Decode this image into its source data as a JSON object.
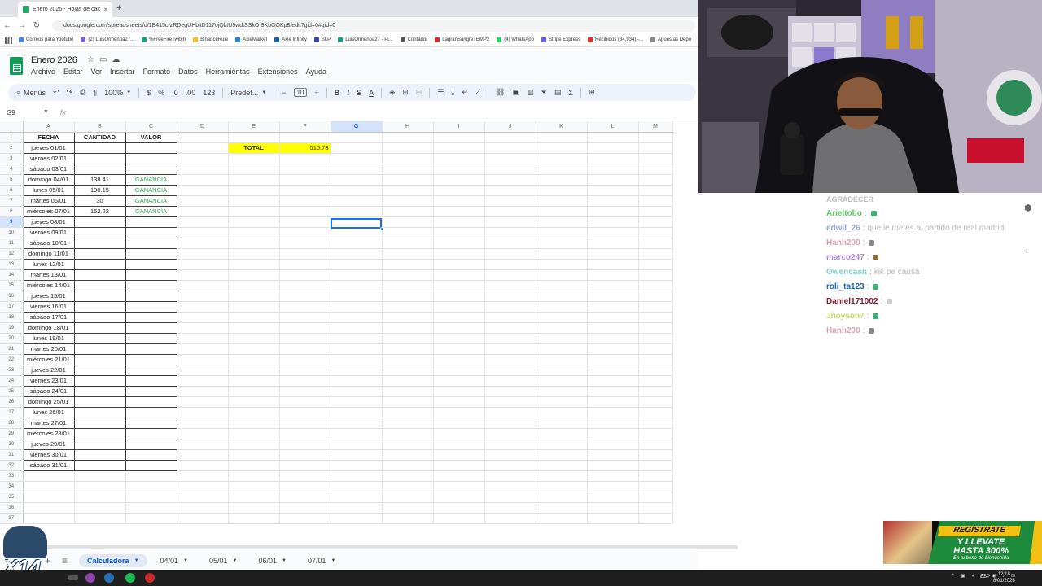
{
  "browser": {
    "tab_title": "Enero 2026 - Hojas de cálculo",
    "tab_close": "×",
    "new_tab": "+",
    "url": "docs.google.com/spreadsheets/d/1B415c-zRDegUHbjtD117ojQktU9wdtSSkO-9KbOQKp8/edit?gid=0#gid=0",
    "bookmarks": [
      {
        "label": "Correos para Youtube",
        "color": "#4285f4"
      },
      {
        "label": "(2) LuisOrmenoa27...",
        "color": "#7b5cd6"
      },
      {
        "label": "%FreeFireTwitch",
        "color": "#16a085"
      },
      {
        "label": "BinanceRule",
        "color": "#f3ba2f"
      },
      {
        "label": "AxieMarket",
        "color": "#1e88e5"
      },
      {
        "label": "Axie Infinity",
        "color": "#1565c0"
      },
      {
        "label": "SLP",
        "color": "#3949ab"
      },
      {
        "label": "LuisOrmenoa27 - Pl...",
        "color": "#16a085"
      },
      {
        "label": "Contador",
        "color": "#555555"
      },
      {
        "label": "LagranSangreTEMP2",
        "color": "#d32f2f"
      },
      {
        "label": "(4) WhatsApp",
        "color": "#25d366"
      },
      {
        "label": "Stripe Express",
        "color": "#635bff"
      },
      {
        "label": "Recibidos (34,934) -...",
        "color": "#d93025"
      },
      {
        "label": "Apuestas Depo",
        "color": "#888888"
      }
    ]
  },
  "doc": {
    "title": "Enero 2026",
    "menu": [
      "Archivo",
      "Editar",
      "Ver",
      "Insertar",
      "Formato",
      "Datos",
      "Herramientas",
      "Extensiones",
      "Ayuda"
    ]
  },
  "toolbar": {
    "search": "Menús",
    "zoom": "100%",
    "currency": "$",
    "percent": "%",
    "dec_less": ".0",
    "dec_more": ".00",
    "number_format": "123",
    "font": "Predet...",
    "font_size": "10"
  },
  "formula": {
    "cell_ref": "G9",
    "fx": "fx"
  },
  "grid": {
    "columns": [
      "A",
      "B",
      "C",
      "D",
      "E",
      "F",
      "G",
      "H",
      "I",
      "J",
      "K",
      "L",
      "M"
    ],
    "selected_column": "G",
    "selected_row": 9,
    "headers": {
      "fecha": "FECHA",
      "cantidad": "CANTIDAD",
      "valor": "VALOR"
    },
    "total_label": "TOTAL",
    "total_value": "510.78",
    "rows": [
      {
        "fecha": "jueves 01/01",
        "cantidad": "",
        "valor": ""
      },
      {
        "fecha": "viernes 02/01",
        "cantidad": "",
        "valor": ""
      },
      {
        "fecha": "sábado 03/01",
        "cantidad": "",
        "valor": ""
      },
      {
        "fecha": "domingo 04/01",
        "cantidad": "138.41",
        "valor": "GANANCIA"
      },
      {
        "fecha": "lunes 05/01",
        "cantidad": "190.15",
        "valor": "GANANCIA"
      },
      {
        "fecha": "martes 06/01",
        "cantidad": "30",
        "valor": "GANANCIA"
      },
      {
        "fecha": "miércoles 07/01",
        "cantidad": "152.22",
        "valor": "GANANCIA"
      },
      {
        "fecha": "jueves 08/01",
        "cantidad": "",
        "valor": ""
      },
      {
        "fecha": "viernes 09/01",
        "cantidad": "",
        "valor": ""
      },
      {
        "fecha": "sábado 10/01",
        "cantidad": "",
        "valor": ""
      },
      {
        "fecha": "domingo 11/01",
        "cantidad": "",
        "valor": ""
      },
      {
        "fecha": "lunes 12/01",
        "cantidad": "",
        "valor": ""
      },
      {
        "fecha": "martes 13/01",
        "cantidad": "",
        "valor": ""
      },
      {
        "fecha": "miércoles 14/01",
        "cantidad": "",
        "valor": ""
      },
      {
        "fecha": "jueves 15/01",
        "cantidad": "",
        "valor": ""
      },
      {
        "fecha": "viernes 16/01",
        "cantidad": "",
        "valor": ""
      },
      {
        "fecha": "sábado 17/01",
        "cantidad": "",
        "valor": ""
      },
      {
        "fecha": "domingo 18/01",
        "cantidad": "",
        "valor": ""
      },
      {
        "fecha": "lunes 19/01",
        "cantidad": "",
        "valor": ""
      },
      {
        "fecha": "martes 20/01",
        "cantidad": "",
        "valor": ""
      },
      {
        "fecha": "miércoles 21/01",
        "cantidad": "",
        "valor": ""
      },
      {
        "fecha": "jueves 22/01",
        "cantidad": "",
        "valor": ""
      },
      {
        "fecha": "viernes 23/01",
        "cantidad": "",
        "valor": ""
      },
      {
        "fecha": "sábado 24/01",
        "cantidad": "",
        "valor": ""
      },
      {
        "fecha": "domingo 25/01",
        "cantidad": "",
        "valor": ""
      },
      {
        "fecha": "lunes 26/01",
        "cantidad": "",
        "valor": ""
      },
      {
        "fecha": "martes 27/01",
        "cantidad": "",
        "valor": ""
      },
      {
        "fecha": "miércoles 28/01",
        "cantidad": "",
        "valor": ""
      },
      {
        "fecha": "jueves 29/01",
        "cantidad": "",
        "valor": ""
      },
      {
        "fecha": "viernes 30/01",
        "cantidad": "",
        "valor": ""
      },
      {
        "fecha": "sábado 31/01",
        "cantidad": "",
        "valor": ""
      }
    ],
    "extra_row_numbers": [
      33,
      34,
      35,
      36,
      37
    ]
  },
  "sheet_tabs": [
    {
      "label": "Calculadora",
      "active": true
    },
    {
      "label": "04/01",
      "active": false
    },
    {
      "label": "05/01",
      "active": false
    },
    {
      "label": "06/01",
      "active": false
    },
    {
      "label": "07/01",
      "active": false
    }
  ],
  "chat": {
    "title": "AGRADECER",
    "messages": [
      {
        "user": "Arieltobo",
        "color": "#5fc95f",
        "text": "",
        "emote": "#3cb371"
      },
      {
        "user": "edwil_26",
        "color": "#9aa4d8",
        "text": "que le metes al partido de real madrid",
        "emote": ""
      },
      {
        "user": "Hanh200",
        "color": "#d6a3b8",
        "text": "",
        "emote": "#888888"
      },
      {
        "user": "marco247",
        "color": "#b388e6",
        "text": "",
        "emote": "#8b6d3a"
      },
      {
        "user": "Owencash",
        "color": "#7fd1c7",
        "text": "kik pe causa",
        "emote": ""
      },
      {
        "user": "roli_ta123",
        "color": "#1565c0",
        "text": "",
        "emote": "#3cb371"
      },
      {
        "user": "Daniel171002",
        "color": "#8e1c2e",
        "text": "",
        "emote": "#cccccc"
      },
      {
        "user": "Jhoyson7",
        "color": "#c5d86d",
        "text": "",
        "emote": "#3cb371"
      },
      {
        "user": "Hanh200",
        "color": "#d6a3b8",
        "text": "",
        "emote": "#888888"
      }
    ]
  },
  "ad": {
    "line1": "REGÍSTRATE",
    "line2a": "Y LLEVATE",
    "line2b": "HASTA 300%",
    "line3": "En tu bono de bienvenida"
  },
  "overlay": {
    "text": "X14"
  },
  "taskbar": {
    "lang": "ESP",
    "time": "12:18",
    "date": "8/01/2026"
  }
}
